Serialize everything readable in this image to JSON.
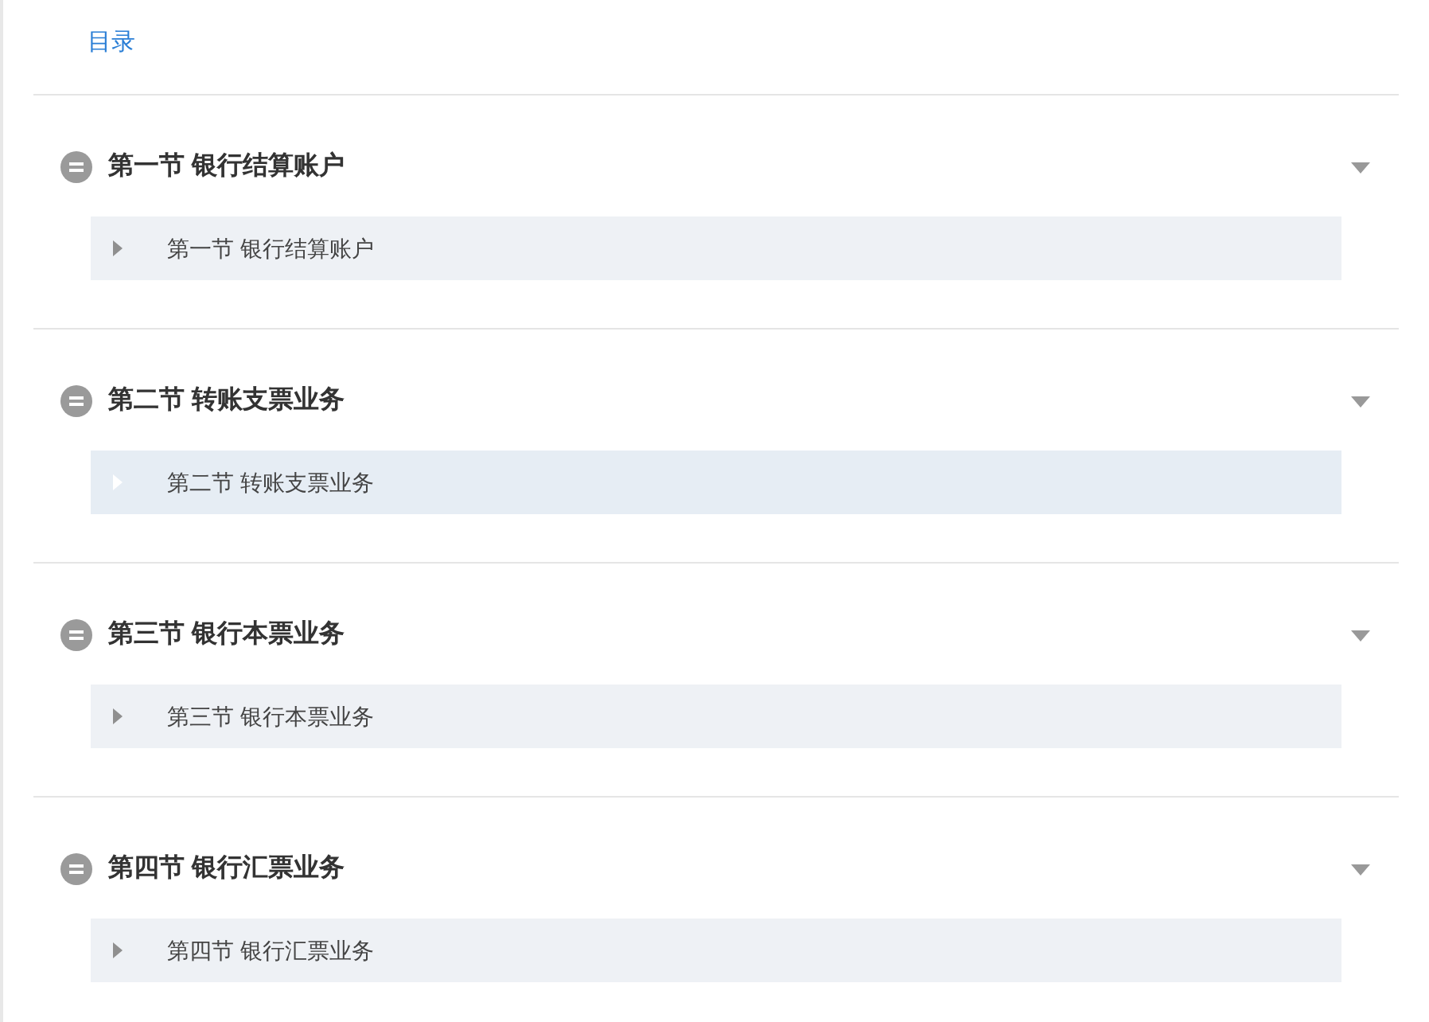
{
  "title": "目录",
  "sections": [
    {
      "title": "第一节 银行结算账户",
      "expanded": true,
      "items": [
        {
          "label": "第一节 银行结算账户",
          "selected": false
        }
      ]
    },
    {
      "title": "第二节 转账支票业务",
      "expanded": true,
      "items": [
        {
          "label": "第二节 转账支票业务",
          "selected": true
        }
      ]
    },
    {
      "title": "第三节 银行本票业务",
      "expanded": true,
      "items": [
        {
          "label": "第三节 银行本票业务",
          "selected": false
        }
      ]
    },
    {
      "title": "第四节 银行汇票业务",
      "expanded": true,
      "items": [
        {
          "label": "第四节 银行汇票业务",
          "selected": false
        }
      ]
    }
  ]
}
